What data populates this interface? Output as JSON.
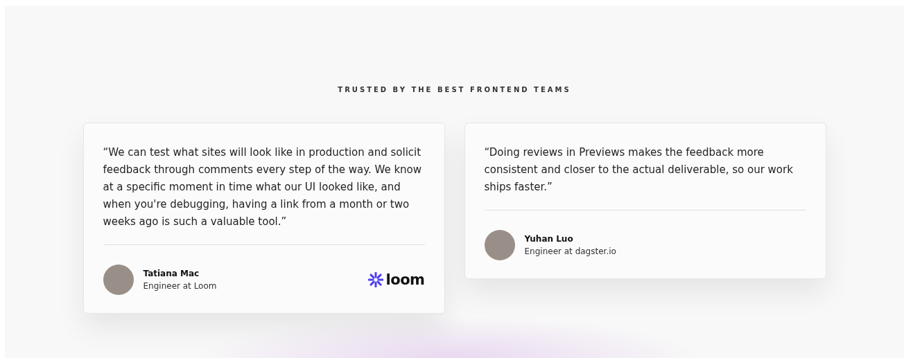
{
  "heading": "TRUSTED BY THE BEST FRONTEND TEAMS",
  "testimonials": [
    {
      "quote": "“We can test what sites will look like in production and solicit feedback through comments every step of the way. We know at a specific moment in time what our UI looked like, and when you're debugging, having a link from a month or two weeks ago is such a valuable tool.”",
      "name": "Tatiana Mac",
      "role": "Engineer at Loom",
      "logo": "loom"
    },
    {
      "quote": "“Doing reviews in Previews makes the feedback more consistent and closer to the actual deliverable, so our work ships faster.”",
      "name": "Yuhan Luo",
      "role": "Engineer at dagster.io"
    }
  ]
}
